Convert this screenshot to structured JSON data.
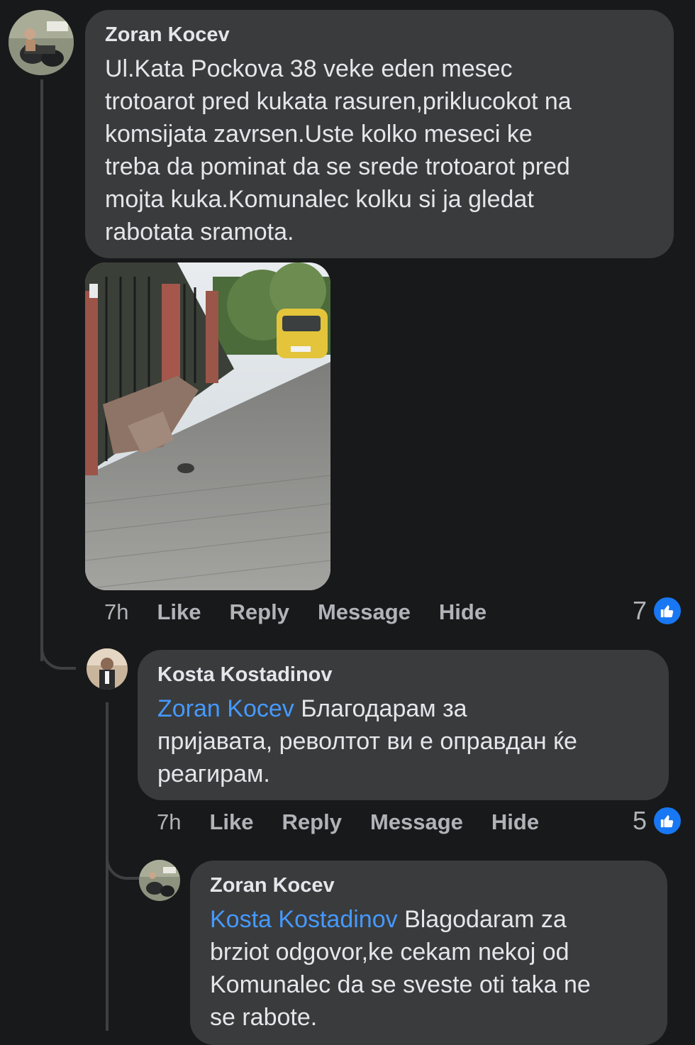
{
  "comments": [
    {
      "author": "Zoran Kocev",
      "text": "Ul.Kata Pockova 38 veke eden mesec trotoarot pred kukata rasuren,priklucokot na komsijata zavrsen.Uste kolko meseci ke treba da pominat da se srede trotoarot pred mojta kuka.Komunalec kolku si ja gledat rabotata sramota.",
      "lines": [
        "Ul.Kata Pockova 38 veke eden mesec",
        "trotoarot pred kukata rasuren,priklucokot na",
        "komsijata zavrsen.Uste kolko meseci ke",
        "treba da pominat da se srede trotoarot pred",
        "mojta kuka.Komunalec kolku si ja gledat",
        "rabotata sramota."
      ],
      "time": "7h",
      "actions": [
        "Like",
        "Reply",
        "Message",
        "Hide"
      ],
      "reactions": "7"
    },
    {
      "author": "Kosta Kostadinov",
      "mention": "Zoran Kocev",
      "lines": [
        " Благодарам за",
        "пријавата, револтот ви е оправдан ќе",
        "реагирам."
      ],
      "time": "7h",
      "actions": [
        "Like",
        "Reply",
        "Message",
        "Hide"
      ],
      "reactions": "5"
    },
    {
      "author": "Zoran Kocev",
      "mention": "Kosta Kostadinov",
      "lines": [
        " Blagodaram za",
        "brziot odgovor,ke cekam nekoj od",
        "Komunalec da se sveste oti taka ne",
        "se rabote."
      ]
    }
  ],
  "colors": {
    "background": "#18191a",
    "bubble": "#3a3b3c",
    "mention": "#4599ff",
    "like": "#1877f2",
    "muted": "#b0b3b8"
  },
  "icons": {
    "reaction": "thumbs-up-icon"
  }
}
